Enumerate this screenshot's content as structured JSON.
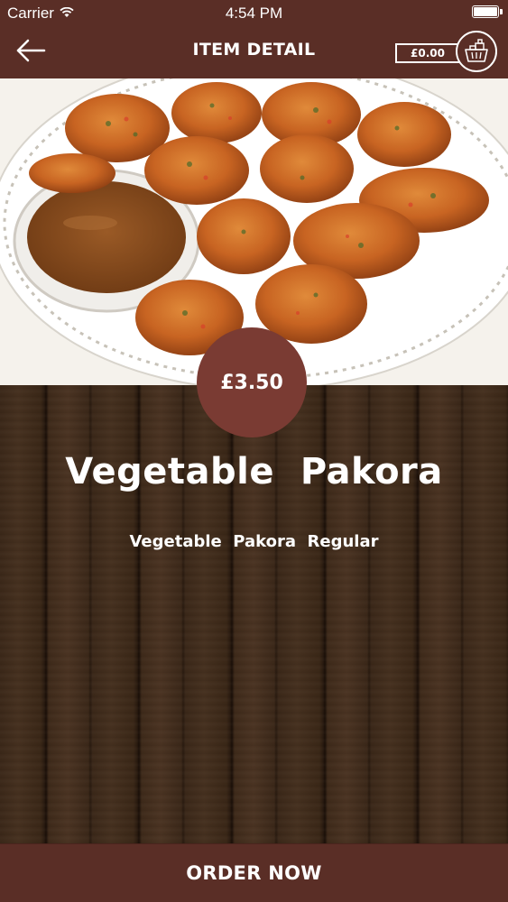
{
  "status_bar": {
    "carrier": "Carrier",
    "time": "4:54 PM",
    "wifi_icon": "wifi-icon",
    "battery_icon": "battery-icon"
  },
  "header": {
    "title": "ITEM DETAIL",
    "back_icon": "back-arrow-icon",
    "cart_total": "£0.00",
    "basket_icon": "basket-icon"
  },
  "item": {
    "image_icon": "vegetable-pakora-photo",
    "price": "£3.50",
    "name": "Vegetable  Pakora",
    "description": "Vegetable  Pakora  Regular"
  },
  "footer": {
    "order_label": "ORDER NOW"
  },
  "colors": {
    "header_brown": "#5a2e26",
    "price_badge": "#7a3b33",
    "wood_dark": "#3b2718",
    "text": "#ffffff"
  }
}
